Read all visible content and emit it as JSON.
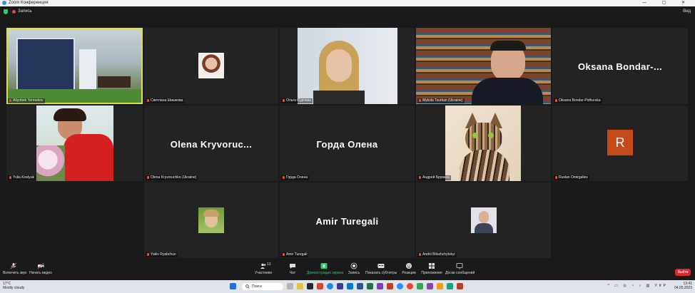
{
  "window": {
    "title": "Zoom Конференция",
    "controls": "— ▢ ✕"
  },
  "topbar": {
    "recording_label": "Запись",
    "view_label": "Вид"
  },
  "participants": [
    {
      "name": "Altynbek Yermekov",
      "kind": "video",
      "active": true
    },
    {
      "name": "Светлана Шишкова",
      "kind": "photo"
    },
    {
      "name": "Ольга Юдічева",
      "kind": "video"
    },
    {
      "name": "Mykola Tsurkan (Ukraine)",
      "kind": "video"
    },
    {
      "name": "Oksana Bondar-Pidhurska",
      "display": "Oksana  Bondar-...",
      "kind": "name"
    },
    {
      "name": "Yulia Kostyuk",
      "kind": "video"
    },
    {
      "name": "Olena Kryvoruchko (Ukraine)",
      "display": "Olena  Kryvoruc...",
      "kind": "name"
    },
    {
      "name": "Горда Олена",
      "display": "Горда Олена",
      "kind": "name"
    },
    {
      "name": "Андрей Бруваха",
      "kind": "photo"
    },
    {
      "name": "Ruslan Omirgaliev",
      "avatar_letter": "R",
      "kind": "avatar"
    },
    {
      "name": "Yakiv Ryabchun",
      "kind": "photo"
    },
    {
      "name": "Amir Turegali",
      "display": "Amir Turegali",
      "kind": "name"
    },
    {
      "name": "Andrii Bilozhchytskyi",
      "kind": "photo"
    }
  ],
  "controls": {
    "unmute": "Включить звук",
    "start_video": "Начать видео",
    "participants": "Участники",
    "participants_count": "13",
    "chat": "Чат",
    "share_screen": "Демонстрация экрана",
    "record": "Запись",
    "subtitles": "Показать субтитры",
    "reactions": "Реакции",
    "apps": "Приложения",
    "whiteboards": "Доски сообщений",
    "end": "Выйти"
  },
  "taskbar": {
    "temperature": "17°C",
    "weather": "Mostly cloudy",
    "search_placeholder": "Поиск",
    "language": "УКР",
    "time": "13:41",
    "date": "04.05.2023"
  },
  "colors": {
    "accent_active": "#d8e23a",
    "share_green": "#2ecc71",
    "end_red": "#e02828",
    "avatar_bg": "#c44a1c"
  }
}
